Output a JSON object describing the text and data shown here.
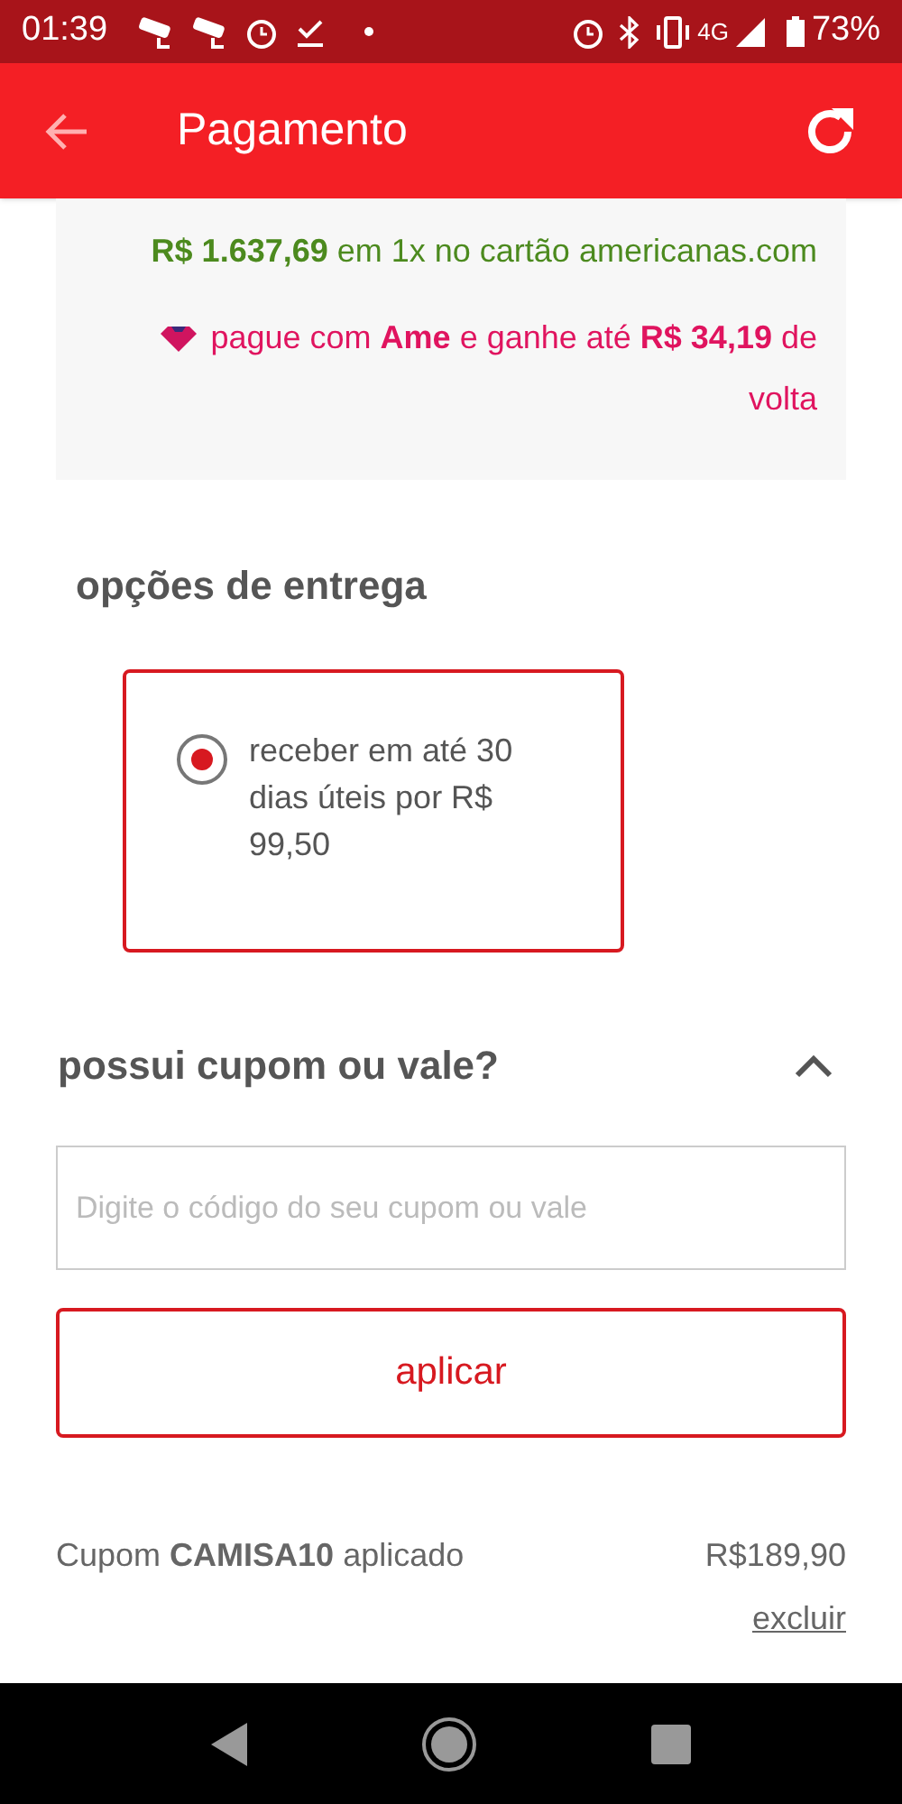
{
  "status_bar": {
    "time": "01:39",
    "network": "4G",
    "battery": "73%"
  },
  "app_bar": {
    "title": "Pagamento"
  },
  "payment_info": {
    "card_offer": "**R$ 1.637,69** em 1x no cartão americanas.com",
    "ame_offer": "pague com **Ame** e ganhe até **R$ 34,19** de volta"
  },
  "delivery": {
    "title": "opções de entrega",
    "options": [
      {
        "label": "receber em até 30 dias úteis por R$ 99,50",
        "selected": true
      }
    ]
  },
  "coupon": {
    "title": "possui cupom ou vale?",
    "expanded": true,
    "placeholder": "Digite o código do seu cupom ou vale",
    "apply_button": "aplicar",
    "applied": "Cupom **CAMISA10** aplicado",
    "amount": "R$189,90",
    "remove_link": "excluir"
  }
}
